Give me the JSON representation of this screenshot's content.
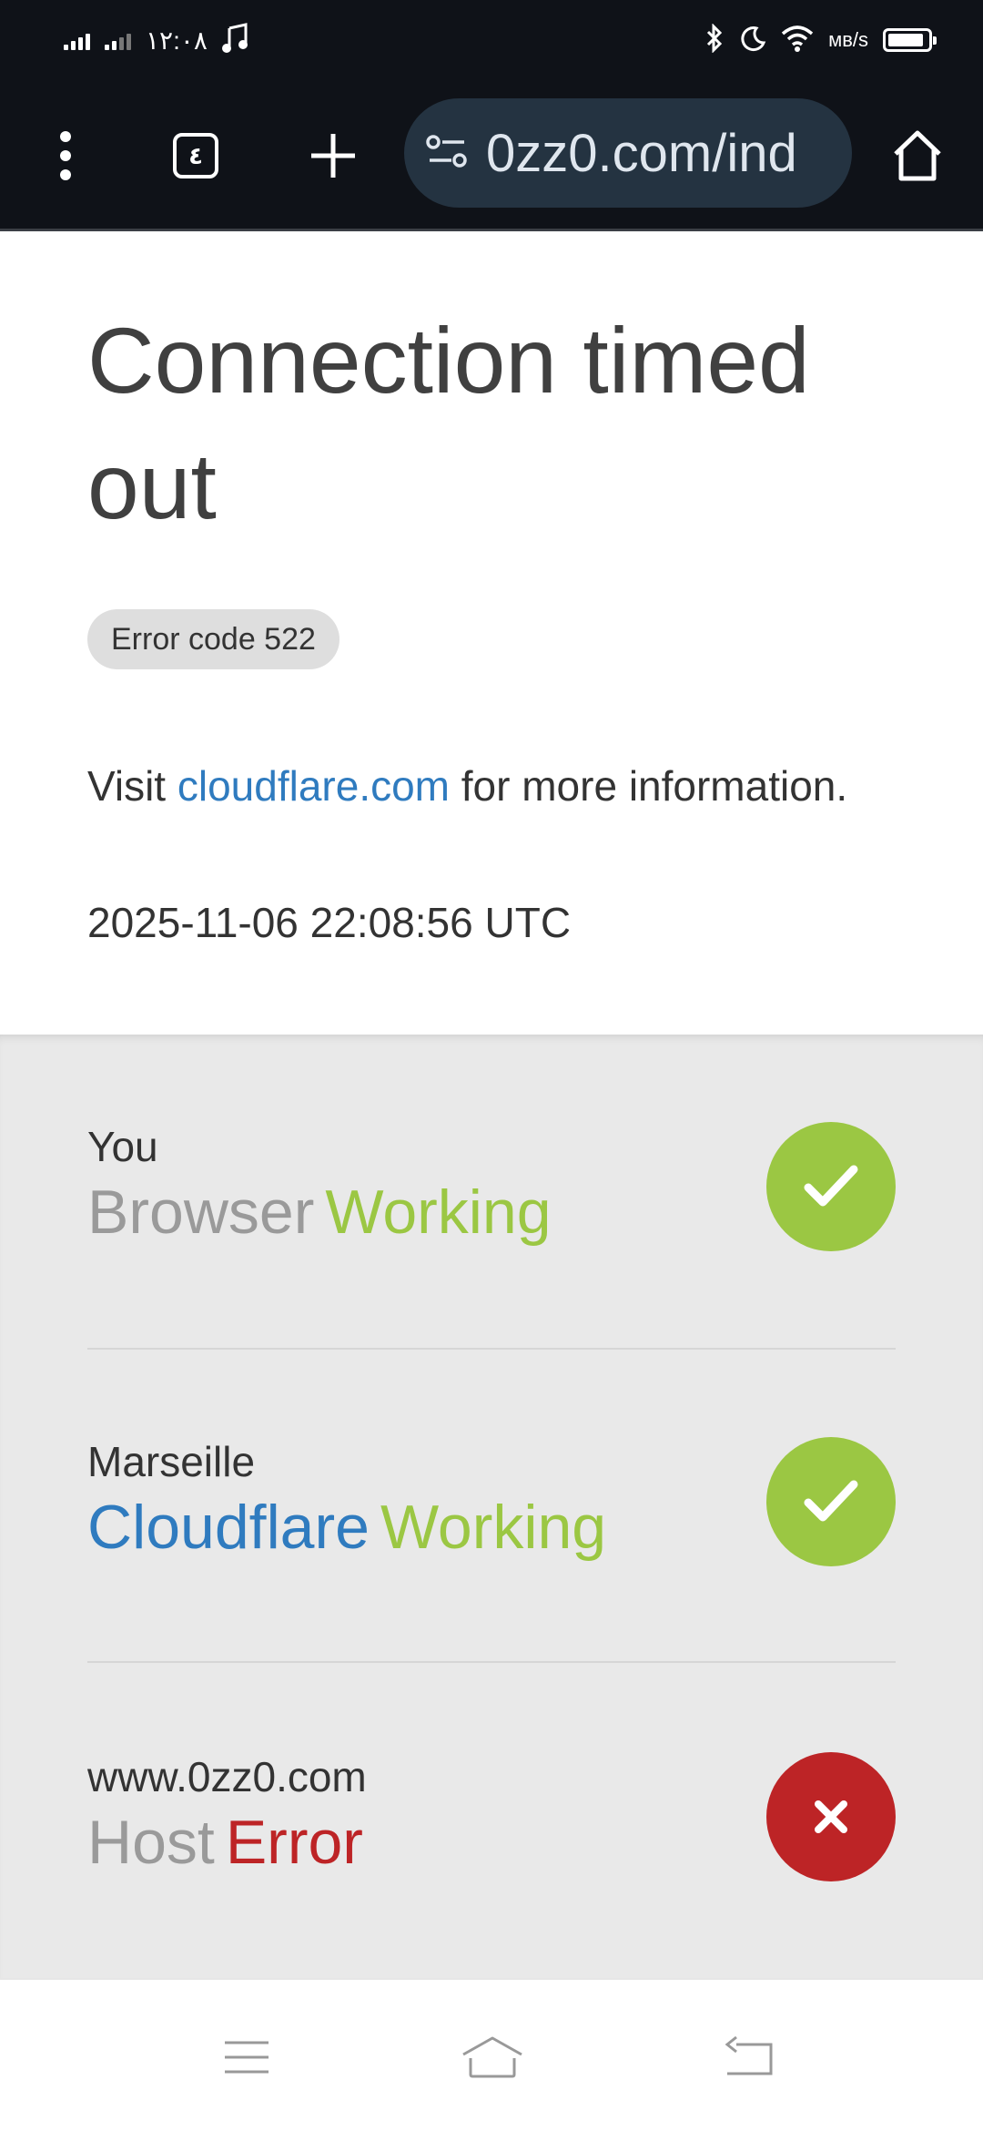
{
  "status_bar": {
    "time": "١٢:٠٨",
    "network_text": "ᴍʙ/s"
  },
  "browser": {
    "url": "0zz0.com/ind",
    "tab_count": "٤"
  },
  "page": {
    "title": "Connection timed out",
    "error_code": "Error code 522",
    "visit_prefix": "Visit ",
    "visit_link": "cloudflare.com",
    "visit_suffix": " for more information.",
    "timestamp": "2025-11-06 22:08:56 UTC"
  },
  "rows": [
    {
      "label": "You",
      "name": "Browser",
      "state": "Working",
      "icon": "check-icon"
    },
    {
      "label": "Marseille",
      "name": "Cloudflare",
      "state": "Working",
      "icon": "check-icon"
    },
    {
      "label": "www.0zz0.com",
      "name": "Host",
      "state": "Error",
      "icon": "close-icon"
    }
  ],
  "colors": {
    "working": "#9bc743",
    "error": "#bd2426",
    "link": "#2f7bbf"
  }
}
